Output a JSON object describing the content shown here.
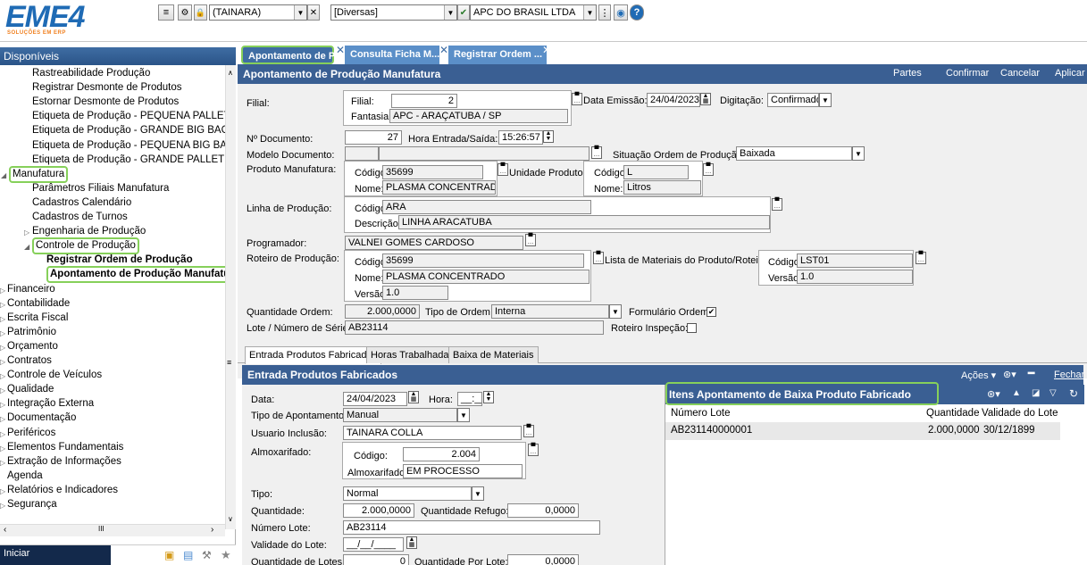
{
  "topbar": {
    "logo_text": "EME4",
    "logo_sub": "SOLUÇÕES EM ERP",
    "user": "(TAINARA)",
    "category": "[Diversas]",
    "company": "APC DO BRASIL LTDA"
  },
  "sidebar": {
    "title": "Disponíveis",
    "items": [
      {
        "label": "Rastreabilidade Produção",
        "indent": 2
      },
      {
        "label": "Registrar Desmonte de Produtos",
        "indent": 2
      },
      {
        "label": "Estornar Desmonte de Produtos",
        "indent": 2
      },
      {
        "label": "Etiqueta de Produção - PEQUENA PALLET",
        "indent": 2
      },
      {
        "label": "Etiqueta de Produção - GRANDE BIG BAG",
        "indent": 2
      },
      {
        "label": "Etiqueta de Produção - PEQUENA BIG BAG",
        "indent": 2
      },
      {
        "label": "Etiqueta de Produção - GRANDE PALLET",
        "indent": 2
      },
      {
        "label": "Manufatura",
        "indent": 1,
        "expander": "◢",
        "highlight": true
      },
      {
        "label": "Parâmetros Filiais Manufatura",
        "indent": 2
      },
      {
        "label": "Cadastros Calendário",
        "indent": 2
      },
      {
        "label": "Cadastros de Turnos",
        "indent": 2
      },
      {
        "label": "Engenharia de Produção",
        "indent": 2,
        "expander": "▷"
      },
      {
        "label": "Controle de Produção",
        "indent": 2,
        "expander": "◢",
        "highlight": true
      },
      {
        "label": "Registrar Ordem de Produção",
        "indent": 3,
        "bold": true
      },
      {
        "label": "Apontamento de Produção Manufatura",
        "indent": 3,
        "bold": true,
        "highlight": true
      },
      {
        "label": "Financeiro",
        "indent": 0,
        "expander": "▷"
      },
      {
        "label": "Contabilidade",
        "indent": 0,
        "expander": "▷"
      },
      {
        "label": "Escrita Fiscal",
        "indent": 0,
        "expander": "▷"
      },
      {
        "label": "Patrimônio",
        "indent": 0,
        "expander": "▷"
      },
      {
        "label": "Orçamento",
        "indent": 0,
        "expander": "▷"
      },
      {
        "label": "Contratos",
        "indent": 0,
        "expander": "▷"
      },
      {
        "label": "Controle de Veículos",
        "indent": 0,
        "expander": "▷"
      },
      {
        "label": "Qualidade",
        "indent": 0,
        "expander": "▷"
      },
      {
        "label": "Integração Externa",
        "indent": 0,
        "expander": "▷"
      },
      {
        "label": "Documentação",
        "indent": 0,
        "expander": "▷"
      },
      {
        "label": "Periféricos",
        "indent": 0,
        "expander": "▷"
      },
      {
        "label": "Elementos Fundamentais",
        "indent": 0,
        "expander": "▷"
      },
      {
        "label": "Extração de Informações",
        "indent": 0,
        "expander": "▷"
      },
      {
        "label": "Agenda",
        "indent": 0
      },
      {
        "label": "Relatórios e Indicadores",
        "indent": 0,
        "expander": "▷"
      },
      {
        "label": "Segurança",
        "indent": 0,
        "expander": "▷"
      }
    ],
    "start_label": "Iniciar"
  },
  "tabs": [
    {
      "label": "Apontamento de P...",
      "active": true
    },
    {
      "label": "Consulta Ficha M...",
      "active": false
    },
    {
      "label": "Registrar Ordem ...",
      "active": false
    }
  ],
  "header": {
    "title": "Apontamento de Produção Manufatura",
    "actions": [
      "Partes",
      "Confirmar",
      "Cancelar",
      "Aplicar"
    ]
  },
  "form": {
    "filial_label": "Filial:",
    "filial_inner_label": "Filial:",
    "filial": "2",
    "fantasia_label": "Fantasia:",
    "fantasia": "APC - ARAÇATUBA / SP",
    "data_emissao_label": "Data Emissão:",
    "data_emissao": "24/04/2023",
    "digitacao_label": "Digitação:",
    "digitacao": "Confirmado",
    "n_documento_label": "Nº Documento:",
    "n_documento": "27",
    "hora_label": "Hora Entrada/Saída:",
    "hora": "15:26:57",
    "modelo_label": "Modelo Documento:",
    "situacao_label": "Situação Ordem de Produção:",
    "situacao": "Baixada",
    "produto_label": "Produto Manufatura:",
    "codigo_label": "Código:",
    "nome_label": "Nome:",
    "produto_codigo": "35699",
    "produto_nome": "PLASMA CONCENTRADO",
    "unidade_label": "Unidade Produto:",
    "unidade_codigo": "L",
    "unidade_nome": "Litros",
    "linha_label": "Linha de Produção:",
    "descricao_label": "Descrição:",
    "linha_codigo": "ARA",
    "linha_descricao": "LINHA ARACATUBA",
    "programador_label": "Programador:",
    "programador": "VALNEI GOMES CARDOSO",
    "roteiro_label": "Roteiro de Produção:",
    "versao_label": "Versão:",
    "roteiro_codigo": "35699",
    "roteiro_nome": "PLASMA CONCENTRADO",
    "roteiro_versao": "1.0",
    "lista_label": "Lista de Materiais do Produto/Roteiro:",
    "lista_codigo": "LST01",
    "lista_versao": "1.0",
    "qtd_ordem_label": "Quantidade Ordem:",
    "qtd_ordem": "2.000,0000",
    "tipo_ordem_label": "Tipo de Ordem:",
    "tipo_ordem": "Interna",
    "formulario_label": "Formulário Ordem:",
    "lote_label": "Lote / Número de Série:",
    "lote": "AB23114",
    "roteiro_insp_label": "Roteiro Inspeção:"
  },
  "subtabs": [
    "Entrada Produtos Fabricados",
    "Horas Trabalhadas",
    "Baixa de Materiais"
  ],
  "pf": {
    "title": "Entrada Produtos Fabricados",
    "acoes": "Ações ▾",
    "fechar": "Fechar",
    "data_label": "Data:",
    "data": "24/04/2023",
    "hora_label": "Hora:",
    "hora": "__:__",
    "tipo_label": "Tipo de Apontamento:",
    "tipo": "Manual",
    "usuario_label": "Usuario Inclusão:",
    "usuario": "TAINARA COLLA",
    "almox_label": "Almoxarifado:",
    "almox_codigo_label": "Código:",
    "almox_codigo": "2.004",
    "almox_nome_label": "Almoxarifado:",
    "almox_nome": "EM PROCESSO",
    "tipo2_label": "Tipo:",
    "tipo2": "Normal",
    "qtd_label": "Quantidade:",
    "qtd": "2.000,0000",
    "refugo_label": "Quantidade Refugo:",
    "refugo": "0,0000",
    "numlote_label": "Número Lote:",
    "numlote": "AB23114",
    "validade_label": "Validade do Lote:",
    "validade": "__/__/____",
    "qtd_lotes_label": "Quantidade de Lotes:",
    "qtd_lotes": "0",
    "qtd_por_lote_label": "Quantidade Por Lote:",
    "qtd_por_lote": "0,0000"
  },
  "items": {
    "title": "Itens Apontamento de Baixa Produto Fabricado",
    "columns": [
      "Número Lote",
      "Quantidade",
      "Validade do Lote"
    ],
    "rows": [
      [
        "AB231140000001",
        "2.000,0000",
        "30/12/1899"
      ]
    ]
  },
  "colors": {
    "header": "#3a5f93",
    "highlight": "#86d05a",
    "tab": "#5b8fc8"
  }
}
